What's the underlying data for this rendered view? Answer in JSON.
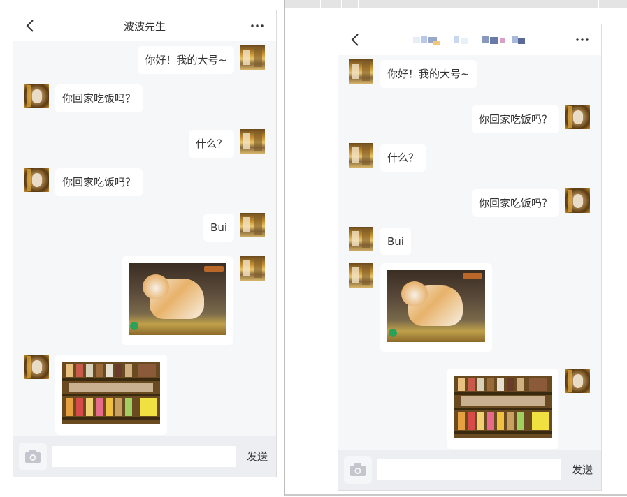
{
  "left_chat": {
    "title": "波波先生",
    "messages": [
      {
        "side": "right",
        "text": "你好！我的大号~"
      },
      {
        "side": "left",
        "text": "你回家吃饭吗？"
      },
      {
        "side": "right",
        "text": "什么？"
      },
      {
        "side": "left",
        "text": "你回家吃饭吗？"
      },
      {
        "side": "right",
        "text": "Bui"
      }
    ],
    "send_label": "发送"
  },
  "right_chat": {
    "messages": [
      {
        "side": "left",
        "text": "你好！我的大号~"
      },
      {
        "side": "right",
        "text": "你回家吃饭吗？"
      },
      {
        "side": "left",
        "text": "什么？"
      },
      {
        "side": "right",
        "text": "你回家吃饭吗？"
      },
      {
        "side": "left",
        "text": "Bui"
      }
    ],
    "send_label": "发送"
  },
  "icons": {
    "back": "chevron-left-icon",
    "more": "more-dots-icon",
    "camera": "camera-icon"
  },
  "colors": {
    "chat_background": "#f6f7f9",
    "bubble": "#ffffff",
    "input_bar": "#eceef2"
  }
}
